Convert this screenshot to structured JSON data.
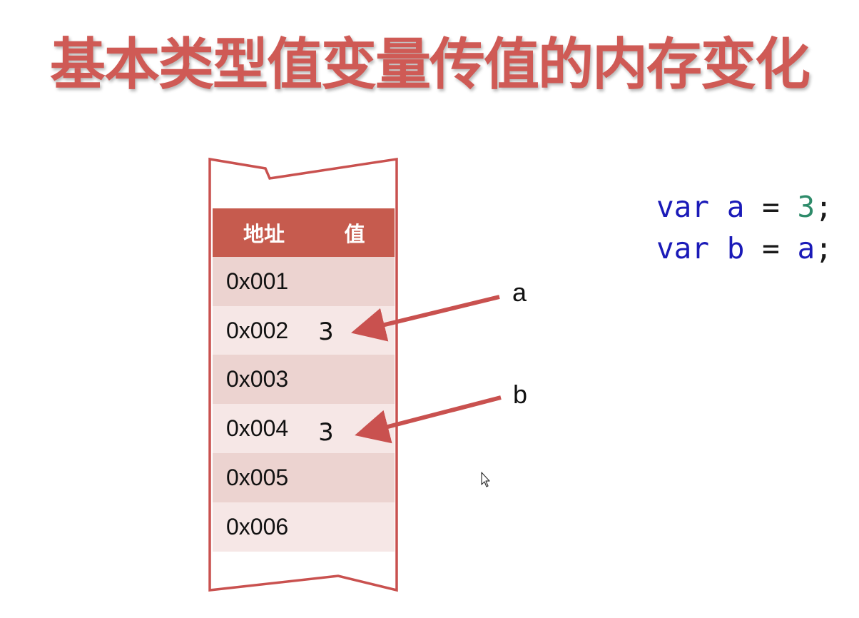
{
  "title": "基本类型值变量传值的内存变化",
  "table": {
    "header": {
      "address": "地址",
      "value": "值"
    },
    "rows": [
      {
        "address": "0x001",
        "value": ""
      },
      {
        "address": "0x002",
        "value": "3"
      },
      {
        "address": "0x003",
        "value": ""
      },
      {
        "address": "0x004",
        "value": "3"
      },
      {
        "address": "0x005",
        "value": ""
      },
      {
        "address": "0x006",
        "value": ""
      }
    ]
  },
  "pointers": [
    {
      "label": "a",
      "target_row": 1
    },
    {
      "label": "b",
      "target_row": 3
    }
  ],
  "code": {
    "lines": [
      {
        "keyword": "var",
        "name": "a",
        "op": "=",
        "value": "3",
        "end": ";"
      },
      {
        "keyword": "var",
        "name": "b",
        "op": "=",
        "value": "a",
        "end": ";"
      }
    ]
  },
  "colors": {
    "accent": "#cf5a55",
    "header_bg": "#c65b4e",
    "row_dark": "#ecd3d0",
    "row_light": "#f6e7e6",
    "code_keyword": "#1a1ab8",
    "code_number": "#2e8b6a"
  }
}
